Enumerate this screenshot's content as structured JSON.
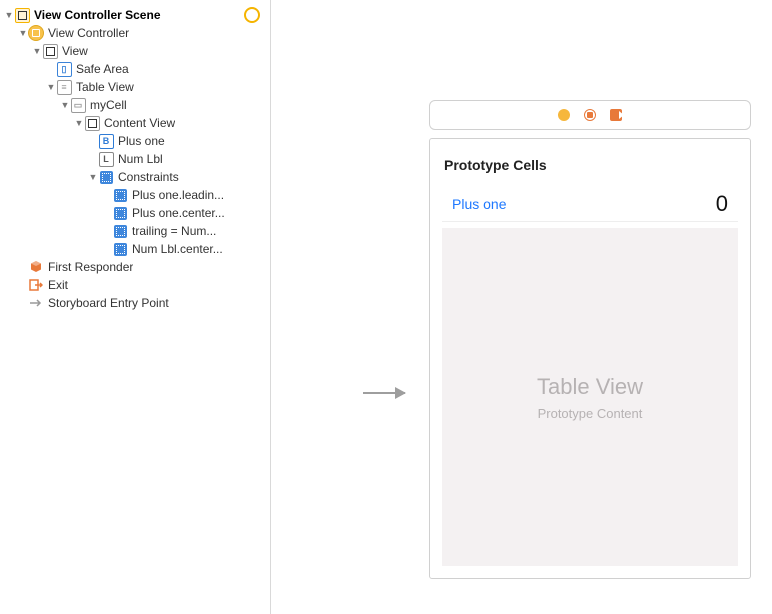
{
  "outline": {
    "scene": "View Controller Scene",
    "vc": "View Controller",
    "view": "View",
    "safeArea": "Safe Area",
    "tableView": "Table View",
    "myCell": "myCell",
    "contentView": "Content View",
    "plusOne": "Plus one",
    "numLbl": "Num Lbl",
    "constraints": "Constraints",
    "c1": "Plus one.leadin...",
    "c2": "Plus one.center...",
    "c3": "trailing = Num...",
    "c4": "Num Lbl.center...",
    "firstResponder": "First Responder",
    "exit": "Exit",
    "entryPoint": "Storyboard Entry Point"
  },
  "canvas": {
    "prototypeTitle": "Prototype Cells",
    "cellButton": "Plus one",
    "cellValue": "0",
    "placeholderTitle": "Table View",
    "placeholderSub": "Prototype Content"
  }
}
